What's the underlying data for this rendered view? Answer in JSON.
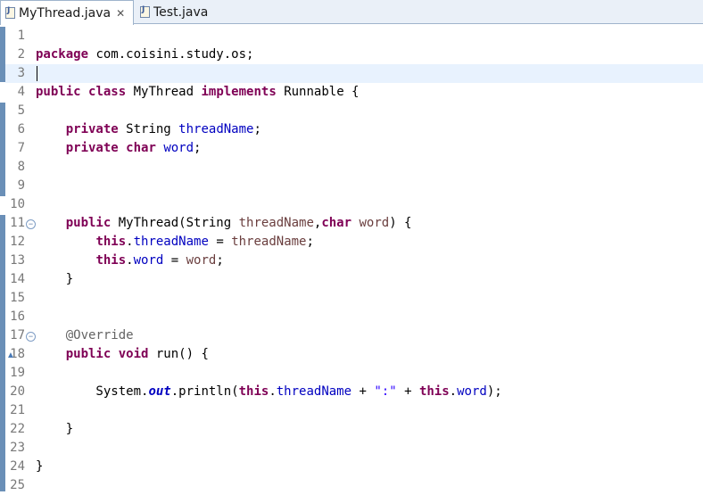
{
  "tabs": [
    {
      "label": "MyThread.java",
      "active": true,
      "closable": true,
      "icon": "java-file-icon"
    },
    {
      "label": "Test.java",
      "active": false,
      "closable": false,
      "icon": "java-file-icon"
    }
  ],
  "editor": {
    "current_line": 3,
    "line_numbers": [
      "1",
      "2",
      "3",
      "4",
      "5",
      "6",
      "7",
      "8",
      "9",
      "10",
      "11",
      "12",
      "13",
      "14",
      "15",
      "16",
      "17",
      "18",
      "19",
      "20",
      "21",
      "22",
      "23",
      "24",
      "25"
    ],
    "lines": [
      "",
      "package com.coisini.study.os;",
      "",
      "public class MyThread implements Runnable {",
      "",
      "    private String threadName;",
      "    private char word;",
      "",
      "",
      "",
      "    public MyThread(String threadName,char word) {",
      "        this.threadName = threadName;",
      "        this.word = word;",
      "    }",
      "",
      "",
      "    @Override",
      "    public void run() {",
      "",
      "        System.out.println(this.threadName + \":\" + this.word);",
      "",
      "    }",
      "",
      "}",
      ""
    ]
  },
  "colors": {
    "keyword": "#7f0055",
    "field": "#0000c0",
    "string": "#2a00ff",
    "annotation": "#646464",
    "current_line": "#e8f2fe",
    "ruler": "#6a8fb7"
  }
}
